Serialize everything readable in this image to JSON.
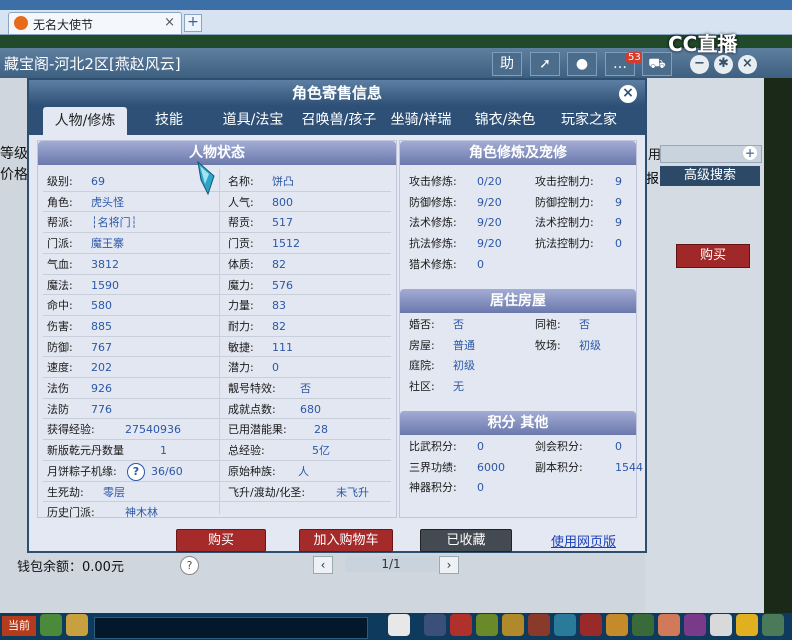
{
  "browser": {
    "tab_title": "无名大使节",
    "tab_close": "×",
    "new_tab": "+"
  },
  "game": {
    "window_title": "藏宝阁-河北2区[燕赵风云]",
    "title_btn_help": "助",
    "notif_count": "53",
    "cc_logo": "CC直播",
    "left_labels": [
      "等级",
      "价格"
    ],
    "right_label": "用",
    "right_label2": "报",
    "advanced_search": "高级搜索",
    "bg_buy": "购买",
    "wallet": "钱包余额：0.00元",
    "page_info": "1/1",
    "taskbar_now": "当前"
  },
  "modal": {
    "title": "角色寄售信息",
    "tabs": [
      "人物/修炼",
      "技能",
      "道具/法宝",
      "召唤兽/孩子",
      "坐骑/祥瑞",
      "锦衣/染色",
      "玩家之家"
    ],
    "left_header": "人物状态",
    "right_header1": "角色修炼及宠修",
    "right_header2": "居住房屋",
    "right_header3": "积分 其他",
    "stats_col1": [
      {
        "label": "级别:",
        "value": "69"
      },
      {
        "label": "角色:",
        "value": "虎头怪"
      },
      {
        "label": "帮派:",
        "value": "┆名将门┆"
      },
      {
        "label": "门派:",
        "value": "魔王寨"
      },
      {
        "label": "气血:",
        "value": "3812"
      },
      {
        "label": "魔法:",
        "value": "1590"
      },
      {
        "label": "命中:",
        "value": "580"
      },
      {
        "label": "伤害:",
        "value": "885"
      },
      {
        "label": "防御:",
        "value": "767"
      },
      {
        "label": "速度:",
        "value": "202"
      },
      {
        "label": "法伤",
        "value": "926"
      },
      {
        "label": "法防",
        "value": "776"
      }
    ],
    "stats_col2": [
      {
        "label": "名称:",
        "value": "饼凸"
      },
      {
        "label": "人气:",
        "value": "800"
      },
      {
        "label": "帮贡:",
        "value": "517"
      },
      {
        "label": "门贡:",
        "value": "1512"
      },
      {
        "label": "体质:",
        "value": "82"
      },
      {
        "label": "魔力:",
        "value": "576"
      },
      {
        "label": "力量:",
        "value": "83"
      },
      {
        "label": "耐力:",
        "value": "82"
      },
      {
        "label": "敏捷:",
        "value": "111"
      },
      {
        "label": "潜力:",
        "value": "0"
      },
      {
        "label": "靓号特效:",
        "value": "否"
      },
      {
        "label": "成就点数:",
        "value": "680"
      }
    ],
    "stats_wide": [
      {
        "l1": "获得经验:",
        "v1": "27540936",
        "l2": "已用潜能果:",
        "v2": "28"
      },
      {
        "l1": "新版乾元丹数量",
        "v1": "1",
        "l2": "总经验:",
        "v2": "5亿"
      },
      {
        "l1": "月饼粽子机缘:",
        "v1": "36/60",
        "l2": "原始种族:",
        "v2": "人"
      },
      {
        "l1": "生死劫:",
        "v1": "零层",
        "l2": "飞升/渡劫/化圣:",
        "v2": "未飞升"
      },
      {
        "l1": "历史门派:",
        "v1": "神木林",
        "l2": "",
        "v2": ""
      }
    ],
    "qmark": "?",
    "cultivation": [
      {
        "l1": "攻击修炼:",
        "v1": "0/20",
        "l2": "攻击控制力:",
        "v2": "9"
      },
      {
        "l1": "防御修炼:",
        "v1": "9/20",
        "l2": "防御控制力:",
        "v2": "9"
      },
      {
        "l1": "法术修炼:",
        "v1": "9/20",
        "l2": "法术控制力:",
        "v2": "9"
      },
      {
        "l1": "抗法修炼:",
        "v1": "9/20",
        "l2": "抗法控制力:",
        "v2": "0"
      },
      {
        "l1": "猎术修炼:",
        "v1": "0",
        "l2": "",
        "v2": ""
      }
    ],
    "house": [
      {
        "l1": "婚否:",
        "v1": "否",
        "l2": "同袍:",
        "v2": "否"
      },
      {
        "l1": "房屋:",
        "v1": "普通",
        "l2": "牧场:",
        "v2": "初级"
      },
      {
        "l1": "庭院:",
        "v1": "初级",
        "l2": "",
        "v2": ""
      },
      {
        "l1": "社区:",
        "v1": "无",
        "l2": "",
        "v2": ""
      }
    ],
    "points": [
      {
        "l1": "比武积分:",
        "v1": "0",
        "l2": "剑会积分:",
        "v2": "0"
      },
      {
        "l1": "三界功绩:",
        "v1": "6000",
        "l2": "副本积分:",
        "v2": "1544"
      },
      {
        "l1": "神器积分:",
        "v1": "0",
        "l2": "",
        "v2": ""
      }
    ],
    "btn_buy": "购买",
    "btn_cart": "加入购物车",
    "btn_fav": "已收藏",
    "web_link": "使用网页版"
  }
}
